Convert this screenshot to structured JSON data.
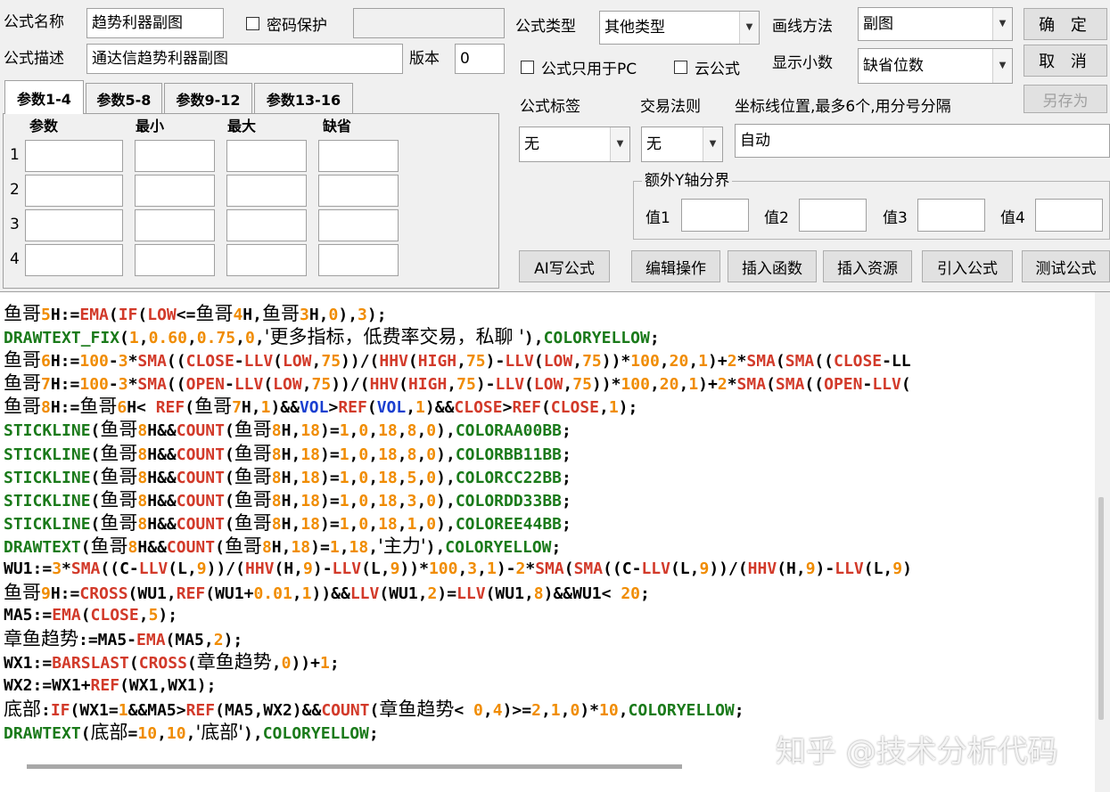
{
  "header": {
    "name_label": "公式名称",
    "name_value": "趋势利器副图",
    "password_label": "密码保护",
    "password_value": "",
    "desc_label": "公式描述",
    "desc_value": "通达信趋势利器副图",
    "version_label": "版本",
    "version_value": "0",
    "type_label": "公式类型",
    "type_value": "其他类型",
    "draw_label": "画线方法",
    "draw_value": "副图",
    "pc_only_label": "公式只用于PC",
    "cloud_label": "云公式",
    "decimals_label": "显示小数",
    "decimals_value": "缺省位数"
  },
  "buttons": {
    "ok": "确 定",
    "cancel": "取 消",
    "save_as": "另存为",
    "ai": "AI写公式",
    "edit_ops": "编辑操作",
    "insert_func": "插入函数",
    "insert_res": "插入资源",
    "import": "引入公式",
    "test": "测试公式"
  },
  "params": {
    "tabs": [
      "参数1-4",
      "参数5-8",
      "参数9-12",
      "参数13-16"
    ],
    "columns": [
      "参数",
      "最小",
      "最大",
      "缺省"
    ],
    "rows": [
      "1",
      "2",
      "3",
      "4"
    ]
  },
  "settings": {
    "tag_label": "公式标签",
    "tag_value": "无",
    "rule_label": "交易法则",
    "rule_value": "无",
    "axis_label": "坐标线位置,最多6个,用分号分隔",
    "axis_value": "自动",
    "extra_y_label": "额外Y轴分界",
    "v1": "值1",
    "v2": "值2",
    "v3": "值3",
    "v4": "值4"
  },
  "code_lines": [
    "鱼哥5H:=EMA(IF(LOW<=鱼哥4H,鱼哥3H,0),3);",
    "DRAWTEXT_FIX(1,0.60,0.75,0,'更多指标，低费率交易，私聊 '),COLORYELLOW;",
    "鱼哥6H:=100-3*SMA((CLOSE-LLV(LOW,75))/(HHV(HIGH,75)-LLV(LOW,75))*100,20,1)+2*SMA(SMA((CLOSE-LL",
    "鱼哥7H:=100-3*SMA((OPEN-LLV(LOW,75))/(HHV(HIGH,75)-LLV(LOW,75))*100,20,1)+2*SMA(SMA((OPEN-LLV(",
    "鱼哥8H:=鱼哥6H< REF(鱼哥7H,1)&&VOL>REF(VOL,1)&&CLOSE>REF(CLOSE,1);",
    "STICKLINE(鱼哥8H&&COUNT(鱼哥8H,18)=1,0,18,8,0),COLORAA00BB;",
    "STICKLINE(鱼哥8H&&COUNT(鱼哥8H,18)=1,0,18,8,0),COLORBB11BB;",
    "STICKLINE(鱼哥8H&&COUNT(鱼哥8H,18)=1,0,18,5,0),COLORCC22BB;",
    "STICKLINE(鱼哥8H&&COUNT(鱼哥8H,18)=1,0,18,3,0),COLORDD33BB;",
    "STICKLINE(鱼哥8H&&COUNT(鱼哥8H,18)=1,0,18,1,0),COLOREE44BB;",
    "DRAWTEXT(鱼哥8H&&COUNT(鱼哥8H,18)=1,18,'主力'),COLORYELLOW;",
    "WU1:=3*SMA((C-LLV(L,9))/(HHV(H,9)-LLV(L,9))*100,3,1)-2*SMA(SMA((C-LLV(L,9))/(HHV(H,9)-LLV(L,9)",
    "鱼哥9H:=CROSS(WU1,REF(WU1+0.01,1))&&LLV(WU1,2)=LLV(WU1,8)&&WU1< 20;",
    "MA5:=EMA(CLOSE,5);",
    "章鱼趋势:=MA5-EMA(MA5,2);",
    "WX1:=BARSLAST(CROSS(章鱼趋势,0))+1;",
    "WX2:=WX1+REF(WX1,WX1);",
    "底部:IF(WX1=1&&MA5>REF(MA5,WX2)&&COUNT(章鱼趋势< 0,4)>=2,1,0)*10,COLORYELLOW;",
    "DRAWTEXT(底部=10,10,'底部'),COLORYELLOW;"
  ],
  "watermark": "知乎 @技术分析代码",
  "colors": {
    "keyword": "#1a7a1a",
    "function": "#d23a2a",
    "number": "#f08c00",
    "builtin": "#1a3fd0"
  }
}
